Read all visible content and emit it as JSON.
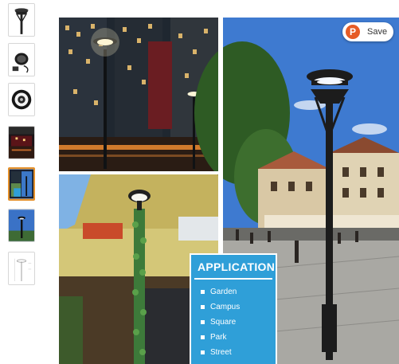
{
  "thumbnails": [
    {
      "name": "thumb-lamp-post",
      "active": false
    },
    {
      "name": "thumb-lamp-installed",
      "active": false
    },
    {
      "name": "thumb-lamp-top-view",
      "active": false
    },
    {
      "name": "thumb-night-street",
      "active": false
    },
    {
      "name": "thumb-application-collage",
      "active": true
    },
    {
      "name": "thumb-lamp-sky",
      "active": false
    },
    {
      "name": "thumb-dimension-drawing",
      "active": false
    }
  ],
  "save_button": {
    "label": "Save",
    "icon": "pinterest-save-icon",
    "color": "#e65c26"
  },
  "application": {
    "title": "APPLICATION",
    "items": [
      "Garden",
      "Campus",
      "Square",
      "Park",
      "Street"
    ],
    "background": "#2f9fd8"
  }
}
